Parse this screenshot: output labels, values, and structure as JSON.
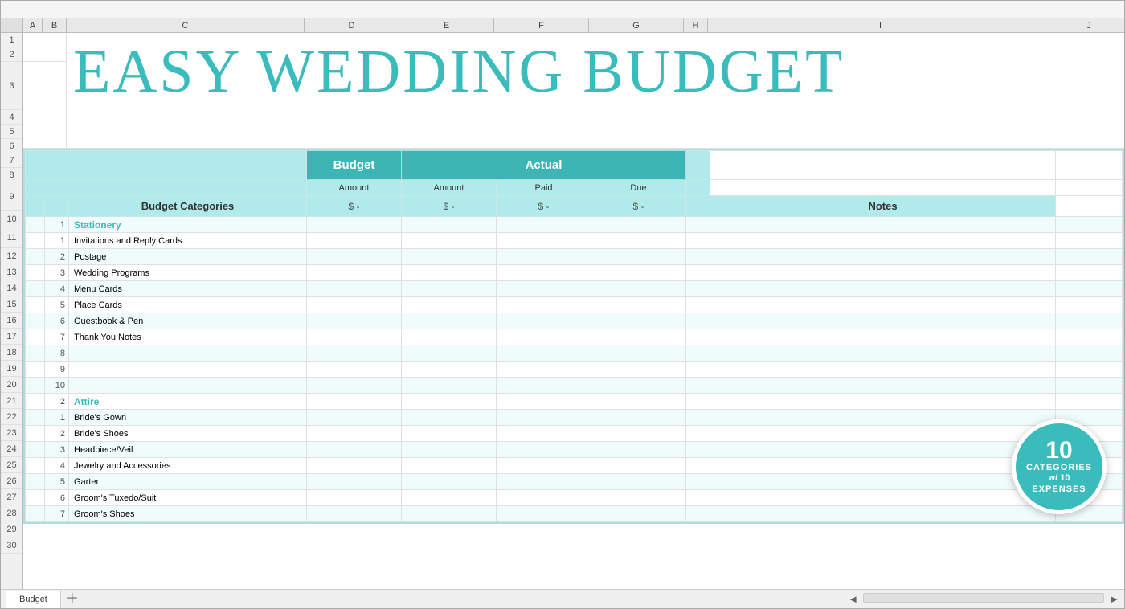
{
  "title": "EASY WEDDING BUDGET",
  "sheet_tab": "Budget",
  "headers": {
    "col_a": "A",
    "col_b": "B",
    "col_c": "C",
    "col_d": "D",
    "col_e": "E",
    "col_f": "F",
    "col_g": "G",
    "col_h": "H",
    "col_i": "I",
    "col_j": "J"
  },
  "table": {
    "budget_label": "Budget",
    "actual_label": "Actual",
    "amount_label": "Amount",
    "paid_label": "Paid",
    "due_label": "Due",
    "budget_categories_label": "Budget Categories",
    "notes_label": "Notes",
    "dollar_dash": "$ -"
  },
  "categories": [
    {
      "num": "1",
      "name": "Stationery",
      "is_category": true
    },
    {
      "num": "1",
      "name": "Invitations and Reply Cards",
      "is_category": false
    },
    {
      "num": "2",
      "name": "Postage",
      "is_category": false
    },
    {
      "num": "3",
      "name": "Wedding Programs",
      "is_category": false
    },
    {
      "num": "4",
      "name": "Menu Cards",
      "is_category": false
    },
    {
      "num": "5",
      "name": "Place Cards",
      "is_category": false
    },
    {
      "num": "6",
      "name": "Guestbook & Pen",
      "is_category": false
    },
    {
      "num": "7",
      "name": "Thank You Notes",
      "is_category": false
    },
    {
      "num": "8",
      "name": "",
      "is_category": false
    },
    {
      "num": "9",
      "name": "",
      "is_category": false
    },
    {
      "num": "10",
      "name": "",
      "is_category": false
    },
    {
      "num": "2",
      "name": "Attire",
      "is_category": true
    },
    {
      "num": "1",
      "name": "Bride's Gown",
      "is_category": false
    },
    {
      "num": "2",
      "name": "Bride's Shoes",
      "is_category": false
    },
    {
      "num": "3",
      "name": "Headpiece/Veil",
      "is_category": false
    },
    {
      "num": "4",
      "name": "Jewelry and Accessories",
      "is_category": false
    },
    {
      "num": "5",
      "name": "Garter",
      "is_category": false
    },
    {
      "num": "6",
      "name": "Groom's Tuxedo/Suit",
      "is_category": false
    },
    {
      "num": "7",
      "name": "Groom's Shoes",
      "is_category": false
    }
  ],
  "row_numbers": [
    "1",
    "2",
    "3",
    "4",
    "5",
    "6",
    "7",
    "8",
    "9",
    "10",
    "11",
    "12",
    "13",
    "14",
    "15",
    "16",
    "17",
    "18",
    "19",
    "20",
    "21",
    "22",
    "23",
    "24",
    "25",
    "26",
    "27",
    "28",
    "29",
    "30"
  ],
  "badge": {
    "num": "10",
    "categories": "CATEGORIES",
    "w": "w/ 10",
    "expenses": "EXPENSES"
  },
  "colors": {
    "teal_dark": "#3db5b5",
    "teal_mid": "#6ecece",
    "teal_light": "#b0e8e8",
    "teal_text": "#3bbcbc",
    "white": "#ffffff",
    "stripe": "#f0fbfb"
  }
}
